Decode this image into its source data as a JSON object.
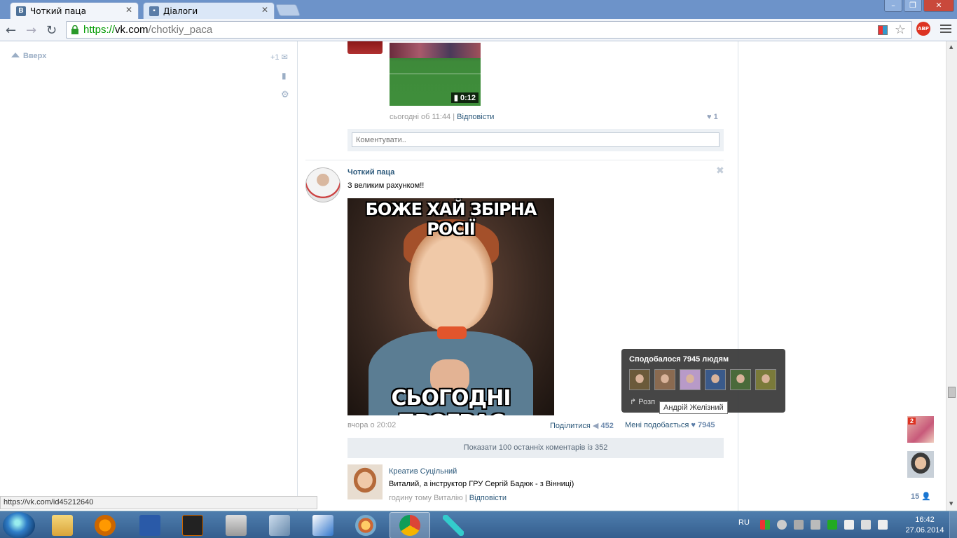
{
  "browser": {
    "tabs": [
      {
        "label": "Чоткий паца",
        "favicon": "В"
      },
      {
        "label": "Діалоги"
      }
    ],
    "url": {
      "scheme": "https://",
      "host": "vk.com",
      "path": "/chotkiy_paca"
    },
    "abp_label": "ABP",
    "status_url": "https://vk.com/id45212640"
  },
  "left": {
    "up_label": "Вверх",
    "mail_count": "+1"
  },
  "feed": {
    "prev_post": {
      "video_duration": "0:12",
      "time": "сьогодні об 11:44",
      "reply": "Відповісти",
      "likes": "1",
      "comment_placeholder": "Коментувати.."
    },
    "post": {
      "author": "Чоткий паца",
      "text": "З великим рахунком!!",
      "meme_top": "БОЖЕ ХАЙ ЗБІРНА РОСІЇ",
      "meme_bottom": "СЬОГОДНІ ПРОГРАЄ",
      "time": "вчора о 20:02",
      "share_label": "Поділитися",
      "share_count": "452",
      "like_label": "Мені подобається",
      "like_count": "7945",
      "show_comments": "Показати 100 останніх коментарів із 352"
    },
    "comment": {
      "author": "Креатив Суцільний",
      "text": "Виталий, а інструктор ГРУ Сергій Бадюк - з Вінниці)",
      "time": "годину тому Виталію",
      "reply": "Відповісти"
    }
  },
  "likes_popup": {
    "title": "Сподобалося 7945 людям",
    "share_label": "Розп",
    "tooltip": "Андрій Желізний",
    "thumb_colors": [
      "#6b5a3a",
      "#8a6a50",
      "#b89ac8",
      "#3a5a8a",
      "#4a6a3a",
      "#7a7a3a"
    ]
  },
  "chat": {
    "unread_badge": "2",
    "friends_online": "15"
  },
  "taskbar": {
    "lang": "RU",
    "time": "16:42",
    "date": "27.06.2014"
  }
}
